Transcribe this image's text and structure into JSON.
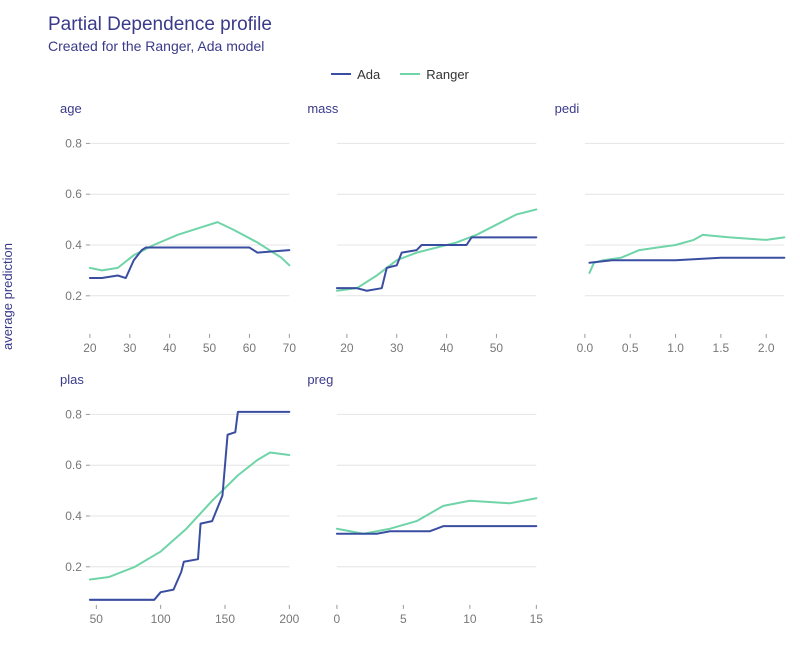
{
  "title": "Partial Dependence profile",
  "subtitle": "Created for the Ranger, Ada model",
  "ylabel": "average prediction",
  "colors": {
    "ada": "#3a4ea1",
    "ranger": "#6fd4a8"
  },
  "legend": [
    {
      "name": "Ada",
      "color_key": "ada"
    },
    {
      "name": "Ranger",
      "color_key": "ranger"
    }
  ],
  "y_ticks": [
    0.2,
    0.4,
    0.6,
    0.8
  ],
  "ylim": [
    0.05,
    0.88
  ],
  "chart_data": [
    {
      "name": "age",
      "xlim": [
        20,
        70
      ],
      "x_ticks": [
        20,
        30,
        40,
        50,
        60,
        70
      ],
      "series": {
        "Ada": {
          "x": [
            20,
            23,
            27,
            29,
            31,
            33,
            34,
            60,
            62,
            70
          ],
          "y": [
            0.27,
            0.27,
            0.28,
            0.27,
            0.34,
            0.38,
            0.39,
            0.39,
            0.37,
            0.38
          ]
        },
        "Ranger": {
          "x": [
            20,
            23,
            27,
            31,
            36,
            42,
            48,
            52,
            56,
            62,
            68,
            70
          ],
          "y": [
            0.31,
            0.3,
            0.31,
            0.36,
            0.4,
            0.44,
            0.47,
            0.49,
            0.46,
            0.41,
            0.35,
            0.32
          ]
        }
      }
    },
    {
      "name": "mass",
      "xlim": [
        18,
        58
      ],
      "x_ticks": [
        20,
        30,
        40,
        50
      ],
      "series": {
        "Ada": {
          "x": [
            18,
            22,
            24,
            27,
            28,
            30,
            31,
            34,
            35,
            44,
            45,
            58
          ],
          "y": [
            0.23,
            0.23,
            0.22,
            0.23,
            0.31,
            0.32,
            0.37,
            0.38,
            0.4,
            0.4,
            0.43,
            0.43
          ]
        },
        "Ranger": {
          "x": [
            18,
            22,
            26,
            30,
            34,
            38,
            42,
            46,
            50,
            54,
            58
          ],
          "y": [
            0.22,
            0.23,
            0.28,
            0.34,
            0.37,
            0.39,
            0.41,
            0.44,
            0.48,
            0.52,
            0.54
          ]
        }
      }
    },
    {
      "name": "pedi",
      "xlim": [
        0.0,
        2.2
      ],
      "x_ticks": [
        0.0,
        0.5,
        1.0,
        1.5,
        2.0
      ],
      "series": {
        "Ada": {
          "x": [
            0.05,
            0.3,
            0.5,
            1.0,
            1.5,
            2.2
          ],
          "y": [
            0.33,
            0.34,
            0.34,
            0.34,
            0.35,
            0.35
          ]
        },
        "Ranger": {
          "x": [
            0.05,
            0.1,
            0.2,
            0.4,
            0.6,
            0.8,
            1.0,
            1.2,
            1.3,
            1.6,
            2.0,
            2.2
          ],
          "y": [
            0.29,
            0.33,
            0.34,
            0.35,
            0.38,
            0.39,
            0.4,
            0.42,
            0.44,
            0.43,
            0.42,
            0.43
          ]
        }
      }
    },
    {
      "name": "plas",
      "xlim": [
        45,
        200
      ],
      "x_ticks": [
        50,
        100,
        150,
        200
      ],
      "series": {
        "Ada": {
          "x": [
            45,
            95,
            100,
            110,
            116,
            118,
            129,
            131,
            140,
            148,
            152,
            158,
            160,
            200
          ],
          "y": [
            0.07,
            0.07,
            0.1,
            0.11,
            0.18,
            0.22,
            0.23,
            0.37,
            0.38,
            0.48,
            0.72,
            0.73,
            0.81,
            0.81
          ]
        },
        "Ranger": {
          "x": [
            45,
            60,
            80,
            100,
            120,
            140,
            160,
            175,
            185,
            200
          ],
          "y": [
            0.15,
            0.16,
            0.2,
            0.26,
            0.35,
            0.46,
            0.56,
            0.62,
            0.65,
            0.64
          ]
        }
      }
    },
    {
      "name": "preg",
      "xlim": [
        0,
        15
      ],
      "x_ticks": [
        0,
        5,
        10,
        15
      ],
      "series": {
        "Ada": {
          "x": [
            0,
            3,
            4,
            7,
            8,
            15
          ],
          "y": [
            0.33,
            0.33,
            0.34,
            0.34,
            0.36,
            0.36
          ]
        },
        "Ranger": {
          "x": [
            0,
            2,
            4,
            6,
            8,
            10,
            13,
            15
          ],
          "y": [
            0.35,
            0.33,
            0.35,
            0.38,
            0.44,
            0.46,
            0.45,
            0.47
          ]
        }
      }
    }
  ]
}
